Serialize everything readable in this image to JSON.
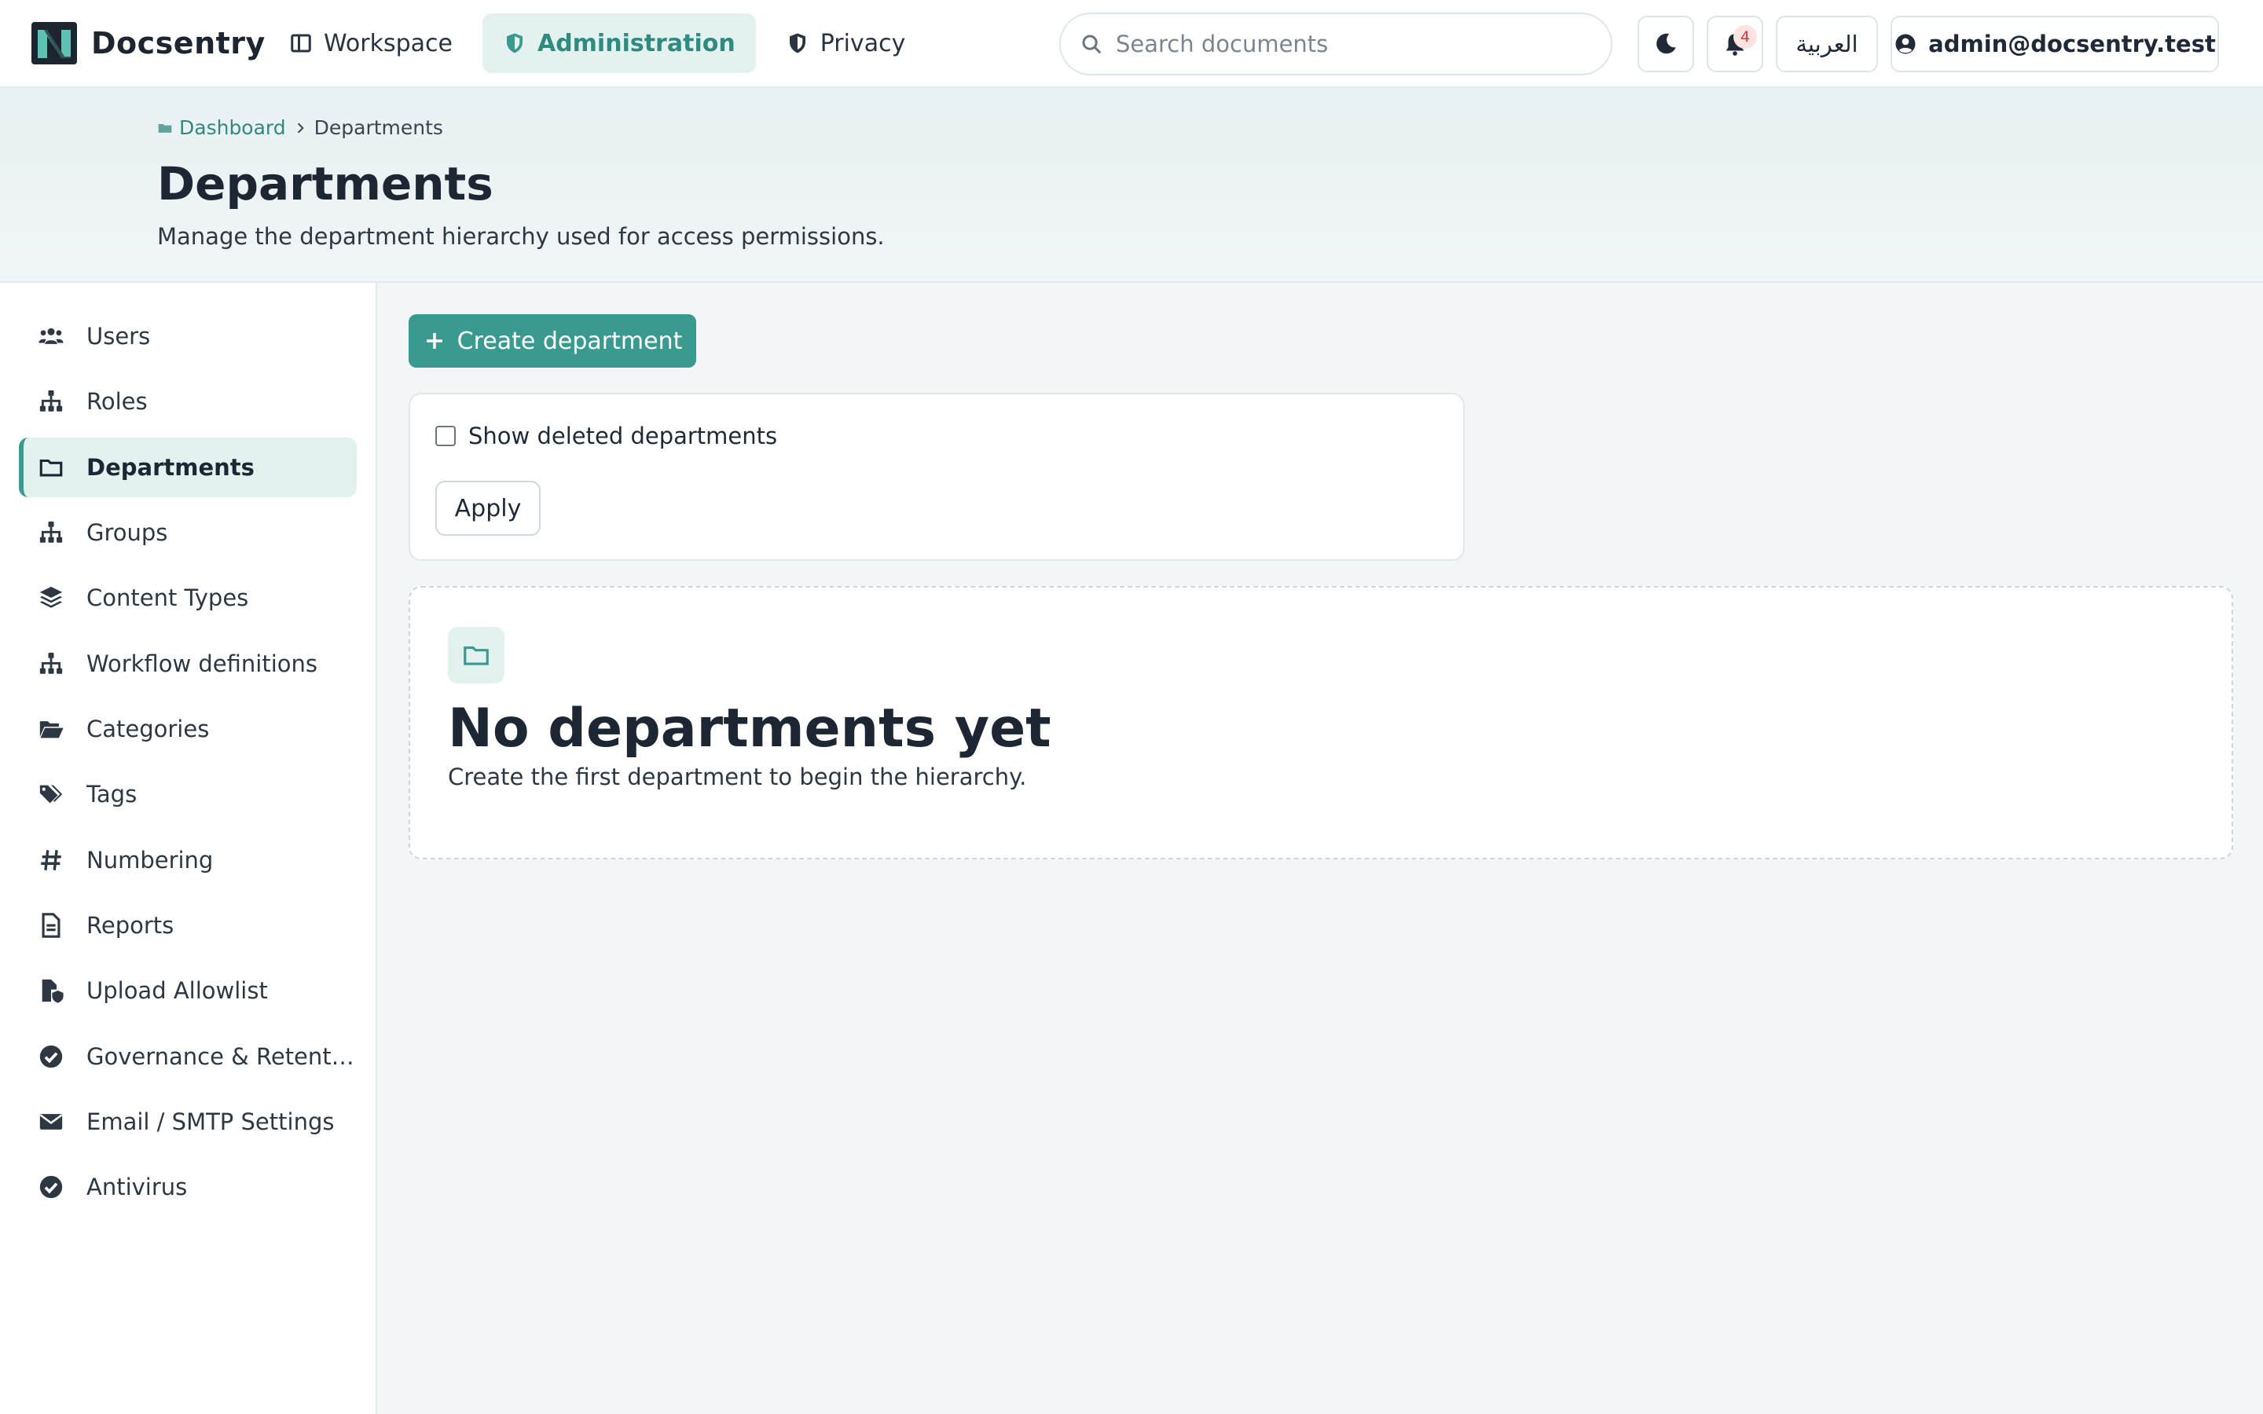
{
  "app": {
    "name": "Docsentry"
  },
  "nav": [
    {
      "label": "Workspace",
      "icon": "layout-icon"
    },
    {
      "label": "Administration",
      "icon": "shield-icon",
      "active": true
    },
    {
      "label": "Privacy",
      "icon": "shield-half-icon"
    }
  ],
  "search": {
    "placeholder": "Search documents",
    "value": ""
  },
  "notifications": {
    "count": "4"
  },
  "language": {
    "label": "العربية"
  },
  "user": {
    "email": "admin@docsentry.test"
  },
  "breadcrumb": {
    "home": "Dashboard",
    "current": "Departments"
  },
  "page": {
    "title": "Departments",
    "subtitle": "Manage the department hierarchy used for access permissions."
  },
  "sidebar": {
    "items": [
      {
        "label": "Users",
        "icon": "users-icon"
      },
      {
        "label": "Roles",
        "icon": "sitemap-icon"
      },
      {
        "label": "Departments",
        "icon": "folder-icon",
        "active": true
      },
      {
        "label": "Groups",
        "icon": "sitemap-icon"
      },
      {
        "label": "Content Types",
        "icon": "layers-icon"
      },
      {
        "label": "Workflow definitions",
        "icon": "sitemap-icon"
      },
      {
        "label": "Categories",
        "icon": "folder-open-icon"
      },
      {
        "label": "Tags",
        "icon": "tags-icon"
      },
      {
        "label": "Numbering",
        "icon": "hash-icon"
      },
      {
        "label": "Reports",
        "icon": "file-icon"
      },
      {
        "label": "Upload Allowlist",
        "icon": "file-shield-icon"
      },
      {
        "label": "Governance & Retent…",
        "icon": "check-circle-icon"
      },
      {
        "label": "Email / SMTP Settings",
        "icon": "envelope-icon"
      },
      {
        "label": "Antivirus",
        "icon": "check-circle-icon"
      }
    ]
  },
  "actions": {
    "create_label": "Create department"
  },
  "filters": {
    "show_deleted_label": "Show deleted departments",
    "show_deleted_checked": false,
    "apply_label": "Apply"
  },
  "empty_state": {
    "title": "No departments yet",
    "text": "Create the first department to begin the hierarchy."
  },
  "colors": {
    "accent": "#3a9a8f",
    "accent_light": "#e3f1ef",
    "badge": "#d13a3a"
  }
}
